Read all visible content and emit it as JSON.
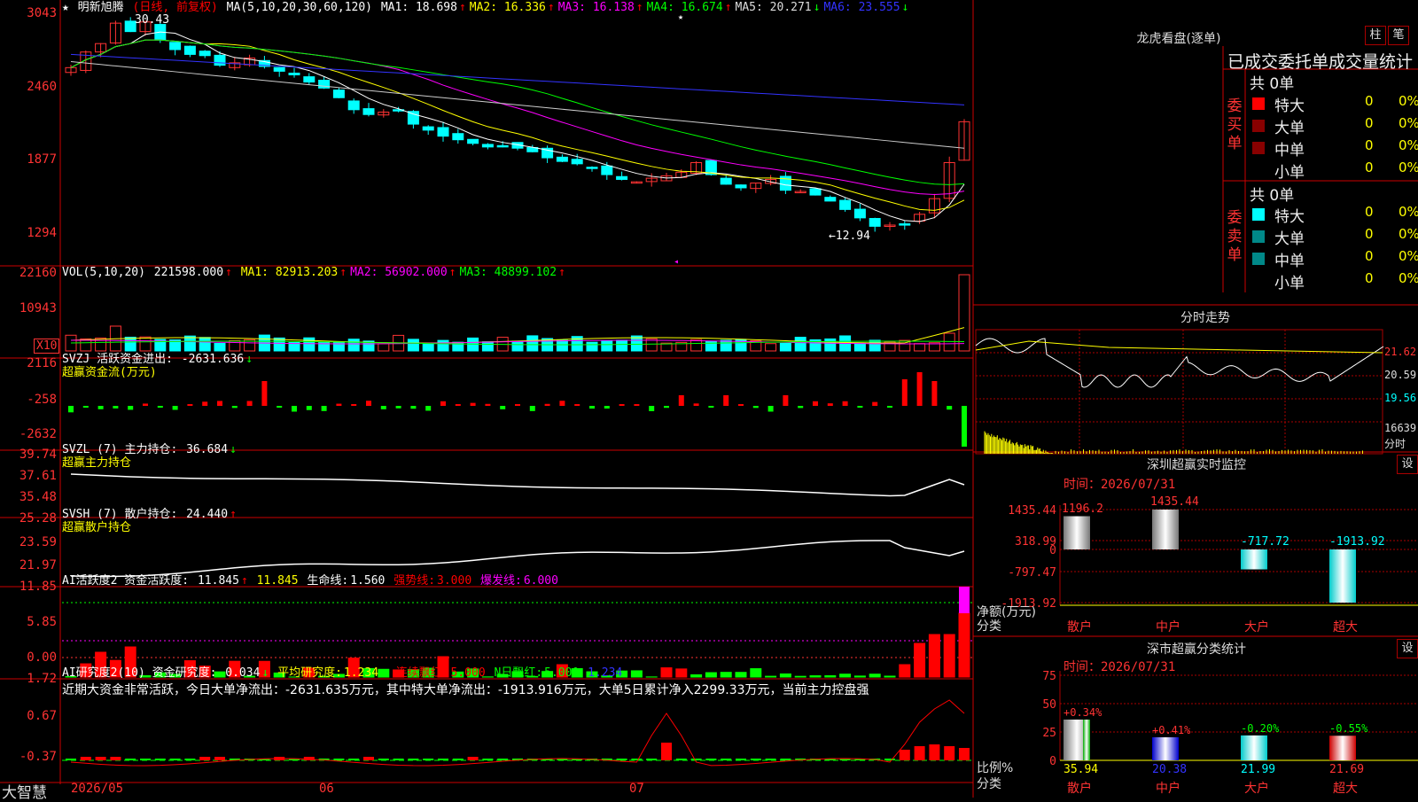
{
  "stock_name": "明新旭腾",
  "stock_mode": "(日线, 前复权)",
  "footer_brand": "大智慧",
  "dates": {
    "d1": "2026/05",
    "d2": "06",
    "d3": "07"
  },
  "main": {
    "y_labels": [
      "3043",
      "2460",
      "1877",
      "1294"
    ],
    "high_label": "30.43",
    "low_label": "←12.94",
    "ma_title": "MA(5,10,20,30,60,120)",
    "ma": [
      {
        "name": "MA1",
        "value": "18.698",
        "arrow": "↑",
        "color": "#ffffff"
      },
      {
        "name": "MA2",
        "value": "16.336",
        "arrow": "↑",
        "color": "#ffff00"
      },
      {
        "name": "MA3",
        "value": "16.138",
        "arrow": "↑",
        "color": "#ff00ff"
      },
      {
        "name": "MA4",
        "value": "16.674",
        "arrow": "↑",
        "color": "#00ff00"
      },
      {
        "name": "MA5",
        "value": "20.271",
        "arrow": "↓",
        "color": "#dddddd"
      },
      {
        "name": "MA6",
        "value": "23.555",
        "arrow": "↓",
        "color": "#3333ff"
      }
    ]
  },
  "vol": {
    "title": "VOL(5,10,20)",
    "value": "221598.000",
    "arrow": "↑",
    "ma": [
      {
        "name": "MA1",
        "value": "82913.203",
        "arrow": "↑",
        "color": "#ffff00"
      },
      {
        "name": "MA2",
        "value": "56902.000",
        "arrow": "↑",
        "color": "#ff00ff"
      },
      {
        "name": "MA3",
        "value": "48899.102",
        "arrow": "↑",
        "color": "#00ff00"
      }
    ],
    "y_labels": [
      "22160",
      "10943"
    ],
    "unit_label": "X10"
  },
  "svzj": {
    "title": "SVZJ 活跃资金进出:",
    "value": "-2631.636",
    "arrow": "↓",
    "subtitle": "超赢资金流(万元)",
    "y_labels": [
      "2116",
      "-258",
      "-2632"
    ]
  },
  "svzl": {
    "title": "SVZL (7) 主力持仓:",
    "value": "36.684",
    "arrow": "↓",
    "subtitle": "超赢主力持仓",
    "y_labels": [
      "39.74",
      "37.61",
      "35.48"
    ]
  },
  "svsh": {
    "title": "SVSH (7) 散户持仓:",
    "value": "24.440",
    "arrow": "↑",
    "subtitle": "超赢散户持仓",
    "y_labels": [
      "25.28",
      "23.59",
      "21.97"
    ]
  },
  "ai1": {
    "title": "AI活跃度2 资金活跃度:",
    "value": "11.845",
    "arrow": "↑",
    "v2": "11.845",
    "life_label": "生命线:",
    "life": "1.560",
    "strong_label": "强势线:",
    "strong": "3.000",
    "burst_label": "爆发线:",
    "burst": "6.000",
    "y_labels": [
      "11.85",
      "5.85",
      "0.00"
    ]
  },
  "ai2": {
    "title": "AI研究度2(10) 资金研究度:",
    "value": "0.034",
    "arrow": "↓",
    "avg_label": "平均研究度:",
    "avg": "1.234",
    "avg_arrow": "↓",
    "red_label": "连续飘红:",
    "red": "5.000",
    "nred_label": "N日飘红:",
    "nred": "5.000",
    "tail": "1.234",
    "comment": "近期大资金非常活跃，今日大单净流出：-2631.635万元，其中特大单净流出：-1913.916万元，大单5日累计净入2299.33万元，当前主力控盘强",
    "y_labels": [
      "1.72",
      "0.67",
      "-0.37"
    ]
  },
  "longhu": {
    "title": "龙虎看盘(逐单)",
    "btn_zhu": "柱",
    "btn_bi": "笔",
    "header": "已成交委托单成交量统计",
    "buy_side": "委买单",
    "sell_side": "委卖单",
    "buy_total": "共 0单",
    "sell_total": "共 0单",
    "rows": [
      {
        "label": "特大",
        "count": "0",
        "pct": "0%"
      },
      {
        "label": "大单",
        "count": "0",
        "pct": "0%"
      },
      {
        "label": "中单",
        "count": "0",
        "pct": "0%"
      },
      {
        "label": "小单",
        "count": "0",
        "pct": "0%"
      }
    ]
  },
  "fenshi": {
    "title": "分时走势",
    "labels": [
      "21.62",
      "20.59",
      "19.56",
      "16639"
    ],
    "unit": "分时"
  },
  "monitor": {
    "title": "深圳超赢实时监控",
    "set": "设",
    "time_label": "时间：",
    "time": "2026/07/31",
    "y_labels": [
      "1435.44",
      "318.99",
      "0",
      "-797.47",
      "-1913.92"
    ],
    "bars": [
      {
        "cat": "散户",
        "value": 1196.2,
        "label": "1196.2"
      },
      {
        "cat": "中户",
        "value": 1435.44,
        "label": "1435.44"
      },
      {
        "cat": "大户",
        "value": -717.72,
        "label": "-717.72"
      },
      {
        "cat": "超大",
        "value": -1913.92,
        "label": "-1913.92"
      }
    ],
    "axis_label1": "净额(万元)",
    "axis_label2": "分类"
  },
  "stats": {
    "title": "深市超赢分类统计",
    "set": "设",
    "time_label": "时间：",
    "time": "2026/07/31",
    "y_labels": [
      "75",
      "50",
      "25",
      "0"
    ],
    "bars": [
      {
        "cat": "散户",
        "value": 35.94,
        "change": "+0.34%"
      },
      {
        "cat": "中户",
        "value": 20.38,
        "change": "+0.41%"
      },
      {
        "cat": "大户",
        "value": 21.99,
        "change": "-0.20%"
      },
      {
        "cat": "超大",
        "value": 21.69,
        "change": "-0.55%"
      }
    ],
    "axis_label1": "比例%",
    "axis_label2": "分类"
  },
  "chart_data": [
    {
      "type": "bar",
      "title": "深圳超赢实时监控",
      "categories": [
        "散户",
        "中户",
        "大户",
        "超大"
      ],
      "values": [
        1196.2,
        1435.44,
        -717.72,
        -1913.92
      ],
      "ylabel": "净额(万元)",
      "ylim": [
        -1913.92,
        1435.44
      ]
    },
    {
      "type": "bar",
      "title": "深市超赢分类统计",
      "categories": [
        "散户",
        "中户",
        "大户",
        "超大"
      ],
      "values": [
        35.94,
        20.38,
        21.99,
        21.69
      ],
      "ylabel": "比例%",
      "ylim": [
        0,
        75
      ]
    }
  ]
}
